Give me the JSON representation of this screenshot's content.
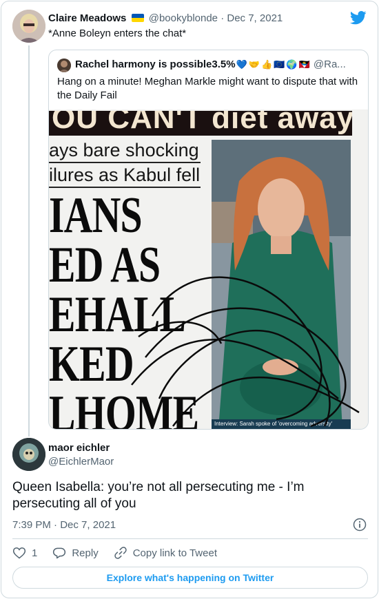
{
  "parent_tweet": {
    "author_name": "Claire Meadows",
    "handle": "@bookyblonde",
    "separator": "·",
    "date": "Dec 7, 2021",
    "text": "*Anne Boleyn enters the chat*",
    "flag_colors": [
      "#0057b7",
      "#ffd700"
    ]
  },
  "quote_tweet": {
    "author_name": "Rachel harmony is possible3.5%",
    "emojis": [
      "💙",
      "🤝",
      "👍",
      "🇪🇺",
      "🌍",
      "🇦🇬"
    ],
    "handle": "@Ra...",
    "text": "Hang on a minute! Meghan Markle might want to dispute that with the Daily Fail",
    "newspaper": {
      "banner": "OU CAN'T diet away...",
      "sub_line_1": "ays bare shocking",
      "sub_line_2": "ilures as Kabul fell",
      "headline_lines": [
        "IANS",
        "ED AS",
        "EHALL",
        "KED",
        "LHOME"
      ],
      "photo_caption": "Interview: Sarah spoke of 'overcoming adversity'"
    }
  },
  "reply": {
    "author_name": "maor eichler",
    "handle": "@EichlerMaor",
    "text": "Queen Isabella: you’re not all persecuting me - I’m persecuting all of you",
    "time": "7:39 PM",
    "separator": "·",
    "date": "Dec 7, 2021",
    "likes": "1",
    "reply_label": "Reply",
    "copy_link_label": "Copy link to Tweet"
  },
  "footer": {
    "explore_label": "Explore what's happening on Twitter"
  },
  "colors": {
    "accent": "#1d9bf0",
    "muted": "#536471",
    "border": "#cfd9de"
  }
}
